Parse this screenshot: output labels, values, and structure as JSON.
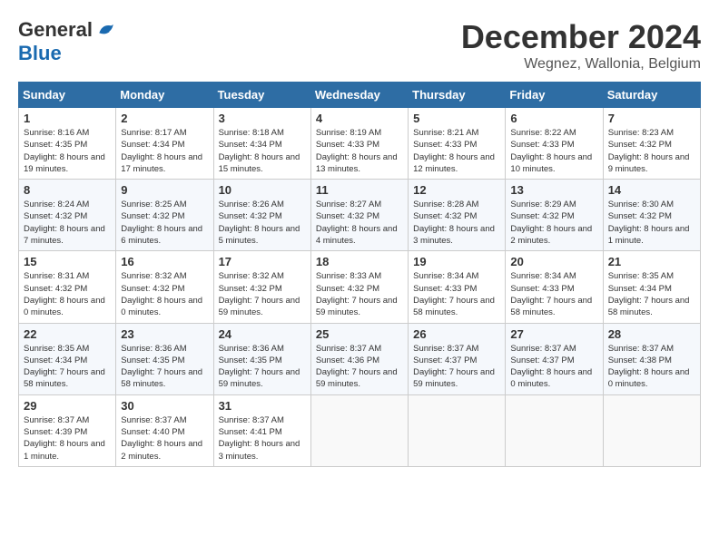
{
  "logo": {
    "general": "General",
    "blue": "Blue"
  },
  "title": {
    "month": "December 2024",
    "location": "Wegnez, Wallonia, Belgium"
  },
  "headers": [
    "Sunday",
    "Monday",
    "Tuesday",
    "Wednesday",
    "Thursday",
    "Friday",
    "Saturday"
  ],
  "weeks": [
    [
      {
        "day": "1",
        "sunrise": "8:16 AM",
        "sunset": "4:35 PM",
        "daylight": "8 hours and 19 minutes."
      },
      {
        "day": "2",
        "sunrise": "8:17 AM",
        "sunset": "4:34 PM",
        "daylight": "8 hours and 17 minutes."
      },
      {
        "day": "3",
        "sunrise": "8:18 AM",
        "sunset": "4:34 PM",
        "daylight": "8 hours and 15 minutes."
      },
      {
        "day": "4",
        "sunrise": "8:19 AM",
        "sunset": "4:33 PM",
        "daylight": "8 hours and 13 minutes."
      },
      {
        "day": "5",
        "sunrise": "8:21 AM",
        "sunset": "4:33 PM",
        "daylight": "8 hours and 12 minutes."
      },
      {
        "day": "6",
        "sunrise": "8:22 AM",
        "sunset": "4:33 PM",
        "daylight": "8 hours and 10 minutes."
      },
      {
        "day": "7",
        "sunrise": "8:23 AM",
        "sunset": "4:32 PM",
        "daylight": "8 hours and 9 minutes."
      }
    ],
    [
      {
        "day": "8",
        "sunrise": "8:24 AM",
        "sunset": "4:32 PM",
        "daylight": "8 hours and 7 minutes."
      },
      {
        "day": "9",
        "sunrise": "8:25 AM",
        "sunset": "4:32 PM",
        "daylight": "8 hours and 6 minutes."
      },
      {
        "day": "10",
        "sunrise": "8:26 AM",
        "sunset": "4:32 PM",
        "daylight": "8 hours and 5 minutes."
      },
      {
        "day": "11",
        "sunrise": "8:27 AM",
        "sunset": "4:32 PM",
        "daylight": "8 hours and 4 minutes."
      },
      {
        "day": "12",
        "sunrise": "8:28 AM",
        "sunset": "4:32 PM",
        "daylight": "8 hours and 3 minutes."
      },
      {
        "day": "13",
        "sunrise": "8:29 AM",
        "sunset": "4:32 PM",
        "daylight": "8 hours and 2 minutes."
      },
      {
        "day": "14",
        "sunrise": "8:30 AM",
        "sunset": "4:32 PM",
        "daylight": "8 hours and 1 minute."
      }
    ],
    [
      {
        "day": "15",
        "sunrise": "8:31 AM",
        "sunset": "4:32 PM",
        "daylight": "8 hours and 0 minutes."
      },
      {
        "day": "16",
        "sunrise": "8:32 AM",
        "sunset": "4:32 PM",
        "daylight": "8 hours and 0 minutes."
      },
      {
        "day": "17",
        "sunrise": "8:32 AM",
        "sunset": "4:32 PM",
        "daylight": "7 hours and 59 minutes."
      },
      {
        "day": "18",
        "sunrise": "8:33 AM",
        "sunset": "4:32 PM",
        "daylight": "7 hours and 59 minutes."
      },
      {
        "day": "19",
        "sunrise": "8:34 AM",
        "sunset": "4:33 PM",
        "daylight": "7 hours and 58 minutes."
      },
      {
        "day": "20",
        "sunrise": "8:34 AM",
        "sunset": "4:33 PM",
        "daylight": "7 hours and 58 minutes."
      },
      {
        "day": "21",
        "sunrise": "8:35 AM",
        "sunset": "4:34 PM",
        "daylight": "7 hours and 58 minutes."
      }
    ],
    [
      {
        "day": "22",
        "sunrise": "8:35 AM",
        "sunset": "4:34 PM",
        "daylight": "7 hours and 58 minutes."
      },
      {
        "day": "23",
        "sunrise": "8:36 AM",
        "sunset": "4:35 PM",
        "daylight": "7 hours and 58 minutes."
      },
      {
        "day": "24",
        "sunrise": "8:36 AM",
        "sunset": "4:35 PM",
        "daylight": "7 hours and 59 minutes."
      },
      {
        "day": "25",
        "sunrise": "8:37 AM",
        "sunset": "4:36 PM",
        "daylight": "7 hours and 59 minutes."
      },
      {
        "day": "26",
        "sunrise": "8:37 AM",
        "sunset": "4:37 PM",
        "daylight": "7 hours and 59 minutes."
      },
      {
        "day": "27",
        "sunrise": "8:37 AM",
        "sunset": "4:37 PM",
        "daylight": "8 hours and 0 minutes."
      },
      {
        "day": "28",
        "sunrise": "8:37 AM",
        "sunset": "4:38 PM",
        "daylight": "8 hours and 0 minutes."
      }
    ],
    [
      {
        "day": "29",
        "sunrise": "8:37 AM",
        "sunset": "4:39 PM",
        "daylight": "8 hours and 1 minute."
      },
      {
        "day": "30",
        "sunrise": "8:37 AM",
        "sunset": "4:40 PM",
        "daylight": "8 hours and 2 minutes."
      },
      {
        "day": "31",
        "sunrise": "8:37 AM",
        "sunset": "4:41 PM",
        "daylight": "8 hours and 3 minutes."
      },
      null,
      null,
      null,
      null
    ]
  ],
  "labels": {
    "sunrise": "Sunrise:",
    "sunset": "Sunset:",
    "daylight": "Daylight:"
  }
}
